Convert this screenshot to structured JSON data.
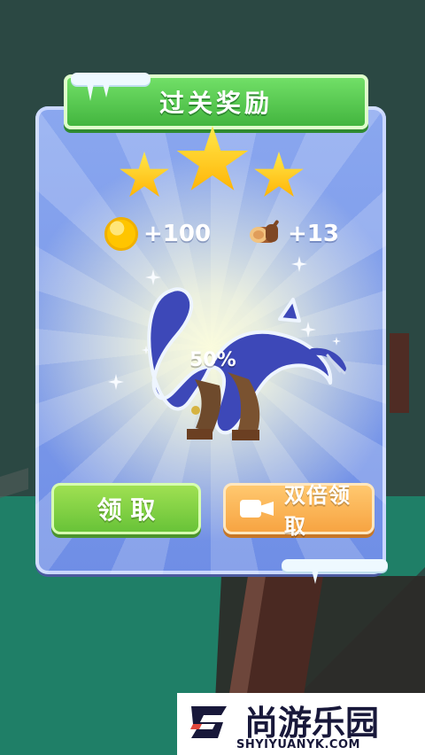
{
  "title": "过关奖励",
  "rewards": {
    "coins": "+100",
    "wood": "+13"
  },
  "progress_label": "50%",
  "buttons": {
    "claim": "领 取",
    "double_claim": "双倍领取"
  },
  "watermark": {
    "brand": "尚游乐园",
    "url": "SHYIYUANYK.COM"
  },
  "colors": {
    "panel_blue": "#7f9cea",
    "title_green": "#4fc64a",
    "claim_green": "#84d344",
    "double_orange": "#f6b04c",
    "star_gold": "#ffc700",
    "coin_gold": "#ffc500",
    "silhouette_blue": "#3c46b6"
  },
  "icons": {
    "coin": "coin-icon",
    "wood": "wood-log-icon",
    "video": "video-camera-icon",
    "stars": "star-icon"
  }
}
